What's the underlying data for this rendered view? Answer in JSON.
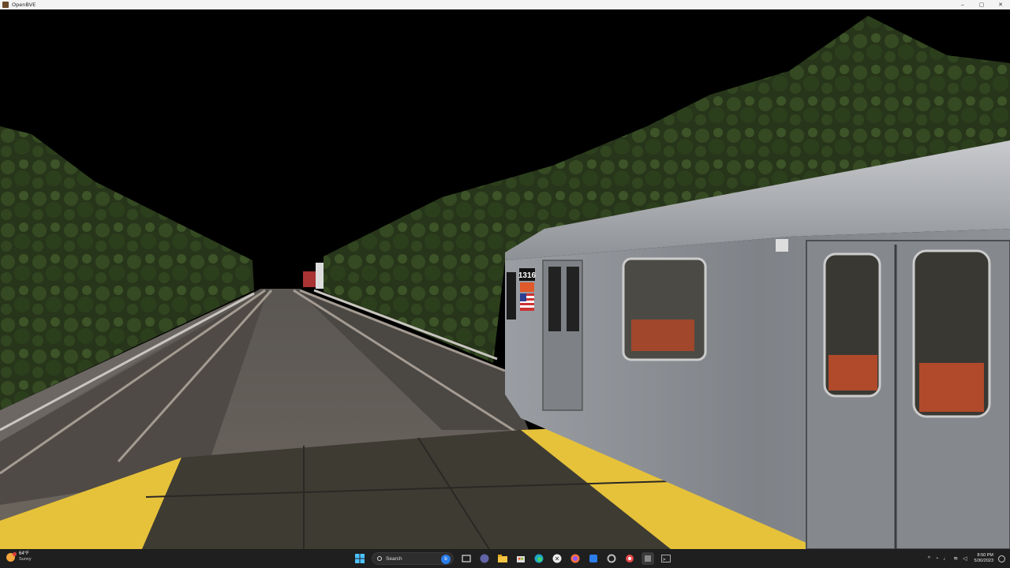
{
  "window": {
    "title": "OpenBVE",
    "minimize": "–",
    "maximize": "▢",
    "close": "✕"
  },
  "scene": {
    "train": {
      "car_number": "1316",
      "flag": "us-flag"
    },
    "colors": {
      "sky": "#000000",
      "platform_edge": "#e8c53a",
      "car_body": "#8a8d90",
      "trees": "#2e3f1d"
    }
  },
  "taskbar": {
    "weather": {
      "temperature": "64°F",
      "condition": "Sunny"
    },
    "search_label": "Search",
    "apps": [
      "windows-start-icon",
      "search",
      "task-view-icon",
      "teams-icon",
      "file-explorer-icon",
      "store-icon",
      "edge-icon",
      "xbox-icon",
      "firefox-icon",
      "todo-icon",
      "settings-icon",
      "snipping-icon",
      "app-icon",
      "terminal-icon"
    ],
    "tray": {
      "chevron": "^",
      "time": "8:50 PM",
      "date": "5/30/2023"
    }
  }
}
